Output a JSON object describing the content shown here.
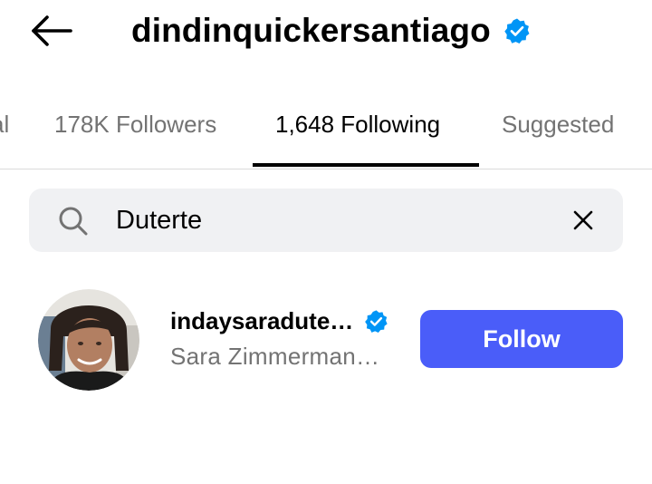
{
  "header": {
    "title": "dindinquickersantiago",
    "back_icon": "arrow-left-icon",
    "verified_icon": "verified-badge-icon"
  },
  "tabs": [
    {
      "label": "al",
      "active": false
    },
    {
      "label": "178K Followers",
      "active": false
    },
    {
      "label": "1,648 Following",
      "active": true
    },
    {
      "label": "Suggested",
      "active": false
    }
  ],
  "search": {
    "value": "Duterte",
    "search_icon": "search-icon",
    "clear_icon": "close-icon"
  },
  "results": [
    {
      "username": "indaysaradute…",
      "full_name": "Sara Zimmerman…",
      "verified": true,
      "button_label": "Follow"
    }
  ],
  "colors": {
    "follow_button": "#4a5df9",
    "verified_badge": "#0095f6",
    "muted_text": "#737373",
    "search_background": "#f0f1f3"
  }
}
